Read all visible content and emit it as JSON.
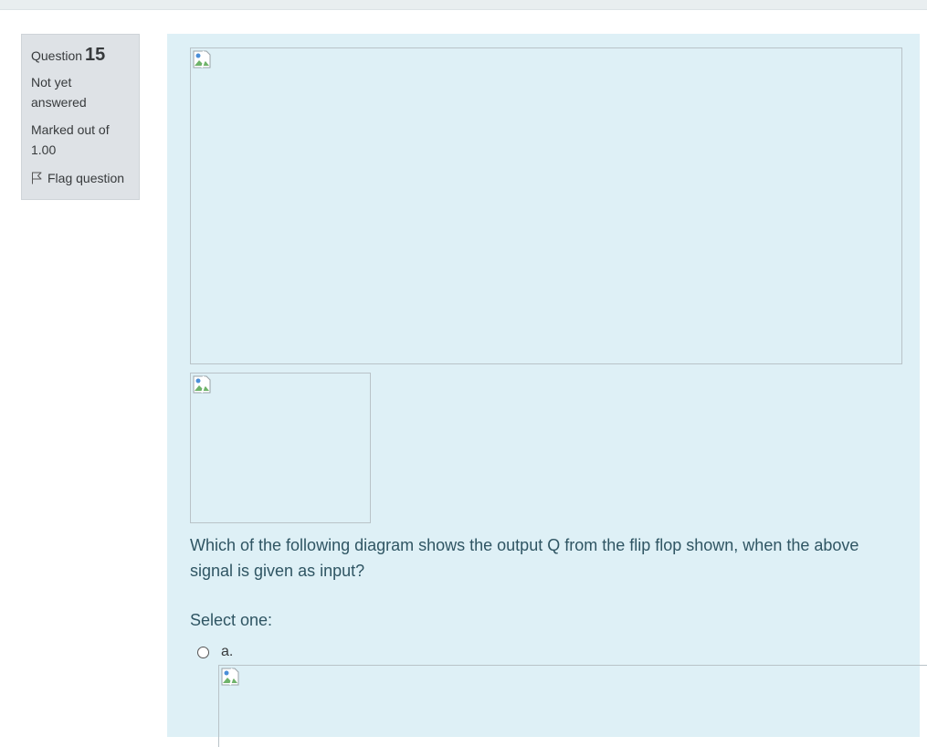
{
  "question_info": {
    "label": "Question",
    "number": "15",
    "state": "Not yet answered",
    "grade": "Marked out of 1.00",
    "flag_label": "Flag question"
  },
  "question": {
    "text": "Which of the following diagram shows the output Q from the flip flop shown, when the above signal is given as input?",
    "prompt": "Select one:",
    "options": [
      {
        "label": "a."
      }
    ]
  },
  "icons": {
    "flag": "flag-icon",
    "broken_image": "broken-image-icon"
  },
  "colors": {
    "content_bg": "#def0f6",
    "info_bg": "#dee2e6",
    "question_text": "#2f5563"
  }
}
